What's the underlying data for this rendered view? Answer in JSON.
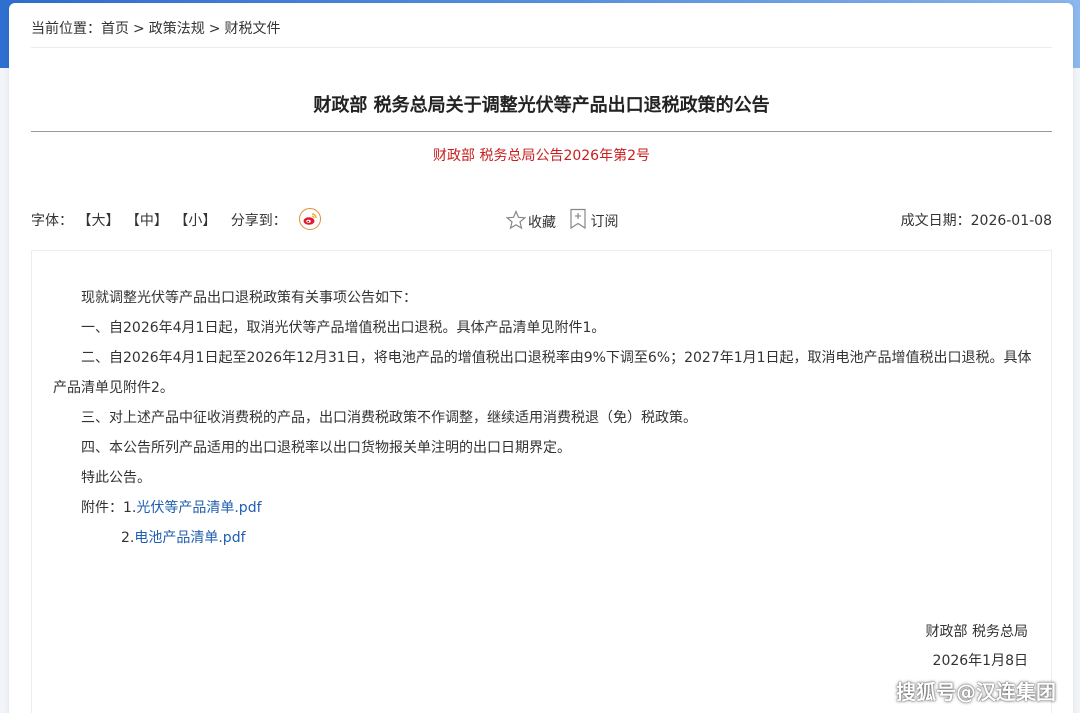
{
  "breadcrumb": {
    "prefix": "当前位置：",
    "items": [
      "首页",
      "政策法规",
      "财税文件"
    ],
    "separator": ">"
  },
  "article": {
    "title": "财政部 税务总局关于调整光伏等产品出口退税政策的公告",
    "doc_number": "财政部 税务总局公告2026年第2号"
  },
  "toolbar": {
    "font_label": "字体：",
    "font_large": "【大】",
    "font_medium": "【中】",
    "font_small": "【小】",
    "share_label": "分享到：",
    "favorite_label": "收藏",
    "subscribe_label": "订阅",
    "date_label": "成文日期：",
    "date_value": "2026-01-08"
  },
  "body": {
    "intro": "现就调整光伏等产品出口退税政策有关事项公告如下：",
    "item1": "一、自2026年4月1日起，取消光伏等产品增值税出口退税。具体产品清单见附件1。",
    "item2": "二、自2026年4月1日起至2026年12月31日，将电池产品的增值税出口退税率由9%下调至6%；2027年1月1日起，取消电池产品增值税出口退税。具体产品清单见附件2。",
    "item3": "三、对上述产品中征收消费税的产品，出口消费税政策不作调整，继续适用消费税退（免）税政策。",
    "item4": "四、本公告所列产品适用的出口退税率以出口货物报关单注明的出口日期界定。",
    "closing": "特此公告。",
    "attachments_label": "附件：",
    "attachment1_prefix": "1.",
    "attachment1": "光伏等产品清单.pdf",
    "attachment2_prefix": "2.",
    "attachment2": "电池产品清单.pdf"
  },
  "signature": {
    "org": "财政部 税务总局",
    "date": "2026年1月8日"
  },
  "watermark": "搜狐号@汉连集团",
  "colors": {
    "doc_number": "#c81e1e",
    "link": "#1f5fb0",
    "header_bg": "#2f6fd0"
  },
  "icons": {
    "share": "weibo-icon",
    "favorite": "star-icon",
    "subscribe": "bookmark-plus-icon"
  }
}
